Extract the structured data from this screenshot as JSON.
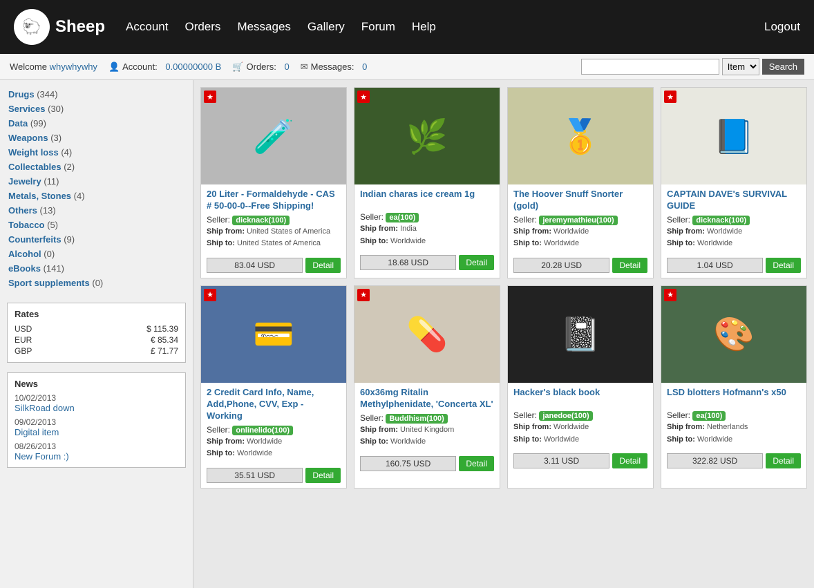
{
  "header": {
    "site_title": "Sheep",
    "logo_icon": "🐑",
    "nav": [
      {
        "label": "Account",
        "name": "nav-account"
      },
      {
        "label": "Orders",
        "name": "nav-orders"
      },
      {
        "label": "Messages",
        "name": "nav-messages"
      },
      {
        "label": "Gallery",
        "name": "nav-gallery"
      },
      {
        "label": "Forum",
        "name": "nav-forum"
      },
      {
        "label": "Help",
        "name": "nav-help"
      }
    ],
    "logout_label": "Logout"
  },
  "subheader": {
    "welcome_prefix": "Welcome",
    "username": "whywhywhy",
    "account_label": "Account:",
    "account_value": "0.00000000 B",
    "orders_label": "Orders:",
    "orders_value": "0",
    "messages_label": "Messages:",
    "messages_value": "0"
  },
  "search": {
    "placeholder": "",
    "item_option": "Item",
    "search_label": "Search"
  },
  "sidebar": {
    "categories": [
      {
        "label": "Drugs",
        "count": "(344)"
      },
      {
        "label": "Services",
        "count": "(30)"
      },
      {
        "label": "Data",
        "count": "(99)"
      },
      {
        "label": "Weapons",
        "count": "(3)"
      },
      {
        "label": "Weight loss",
        "count": "(4)"
      },
      {
        "label": "Collectables",
        "count": "(2)"
      },
      {
        "label": "Jewelry",
        "count": "(11)"
      },
      {
        "label": "Metals, Stones",
        "count": "(4)"
      },
      {
        "label": "Others",
        "count": "(13)"
      },
      {
        "label": "Tobacco",
        "count": "(5)"
      },
      {
        "label": "Counterfeits",
        "count": "(9)"
      },
      {
        "label": "Alcohol",
        "count": "(0)"
      },
      {
        "label": "eBooks",
        "count": "(141)"
      },
      {
        "label": "Sport supplements",
        "count": "(0)"
      }
    ],
    "rates": {
      "title": "Rates",
      "rows": [
        {
          "currency": "USD",
          "symbol": "$",
          "value": "115.39"
        },
        {
          "currency": "EUR",
          "symbol": "€",
          "value": "85.34"
        },
        {
          "currency": "GBP",
          "symbol": "£",
          "value": "71.77"
        }
      ]
    },
    "news": {
      "title": "News",
      "items": [
        {
          "date": "10/02/2013",
          "link": "SilkRoad down"
        },
        {
          "date": "09/02/2013",
          "link": "Digital item"
        },
        {
          "date": "08/26/2013",
          "link": "New Forum :)"
        }
      ]
    }
  },
  "products": [
    {
      "id": "p1",
      "title": "20 Liter - Formaldehyde - CAS # 50-00-0--Free Shipping!",
      "seller": "dicknack(100)",
      "seller_color": "#4a4",
      "ship_from": "United States of America",
      "ship_to": "United States of America",
      "price": "83.04 USD",
      "starred": true,
      "img_class": "img-formaldehyde",
      "img_emoji": "🧪",
      "detail_label": "Detail"
    },
    {
      "id": "p2",
      "title": "Indian charas ice cream 1g",
      "seller": "ea(100)",
      "seller_color": "#4a4",
      "ship_from": "India",
      "ship_to": "Worldwide",
      "price": "18.68 USD",
      "starred": true,
      "img_class": "img-charas",
      "img_emoji": "🌿",
      "detail_label": "Detail"
    },
    {
      "id": "p3",
      "title": "The Hoover Snuff Snorter (gold)",
      "seller": "jeremymathieu(100)",
      "seller_color": "#4a4",
      "ship_from": "Worldwide",
      "ship_to": "Worldwide",
      "price": "20.28 USD",
      "starred": false,
      "img_class": "img-snorter",
      "img_emoji": "🥇",
      "detail_label": "Detail"
    },
    {
      "id": "p4",
      "title": "CAPTAIN DAVE's SURVIVAL GUIDE",
      "seller": "dicknack(100)",
      "seller_color": "#4a4",
      "ship_from": "Worldwide",
      "ship_to": "Worldwide",
      "price": "1.04 USD",
      "starred": true,
      "img_class": "img-book",
      "img_emoji": "📘",
      "detail_label": "Detail"
    },
    {
      "id": "p5",
      "title": "2 Credit Card Info, Name, Add,Phone, CVV, Exp - Working",
      "seller": "onlinelido(100)",
      "seller_color": "#4a4",
      "ship_from": "Worldwide",
      "ship_to": "Worldwide",
      "price": "35.51 USD",
      "starred": true,
      "img_class": "img-cards",
      "img_emoji": "💳",
      "detail_label": "Detail"
    },
    {
      "id": "p6",
      "title": "60x36mg Ritalin Methylphenidate, 'Concerta XL'",
      "seller": "Buddhism(100)",
      "seller_color": "#4a4",
      "ship_from": "United Kingdom",
      "ship_to": "Worldwide",
      "price": "160.75 USD",
      "starred": true,
      "img_class": "img-ritalin",
      "img_emoji": "💊",
      "detail_label": "Detail"
    },
    {
      "id": "p7",
      "title": "Hacker's black book",
      "seller": "janedoe(100)",
      "seller_color": "#4a4",
      "ship_from": "Worldwide",
      "ship_to": "Worldwide",
      "price": "3.11 USD",
      "starred": false,
      "img_class": "img-blackbook",
      "img_emoji": "📓",
      "detail_label": "Detail"
    },
    {
      "id": "p8",
      "title": "LSD blotters Hofmann's x50",
      "seller": "ea(100)",
      "seller_color": "#4a4",
      "ship_from": "Netherlands",
      "ship_to": "Worldwide",
      "price": "322.82 USD",
      "starred": true,
      "img_class": "img-lsd",
      "img_emoji": "🎨",
      "detail_label": "Detail"
    }
  ]
}
